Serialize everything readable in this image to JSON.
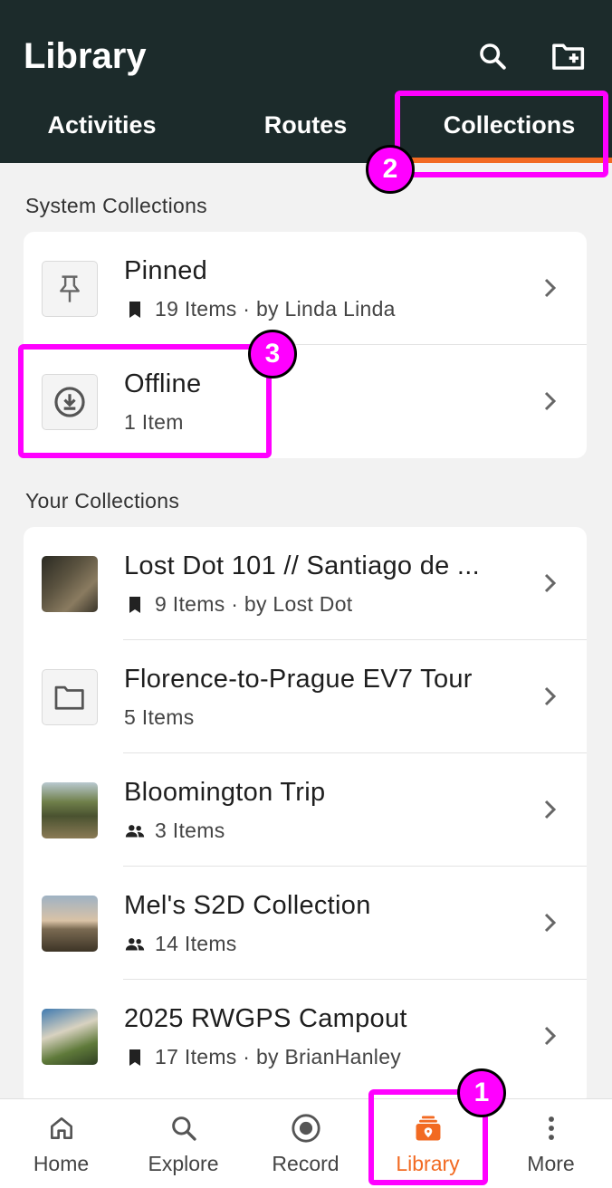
{
  "header": {
    "title": "Library",
    "search_icon": "search-icon",
    "new_folder_icon": "folder-add-icon"
  },
  "tabs": [
    {
      "label": "Activities",
      "selected": false
    },
    {
      "label": "Routes",
      "selected": false
    },
    {
      "label": "Collections",
      "selected": true
    }
  ],
  "system_collections": {
    "title": "System Collections",
    "items": [
      {
        "title": "Pinned",
        "icon": "pin-icon",
        "sub_icon": "bookmark-icon",
        "subtitle": "19 Items · by Linda Linda"
      },
      {
        "title": "Offline",
        "icon": "download-icon",
        "sub_icon": "",
        "subtitle": "1 Item"
      }
    ]
  },
  "your_collections": {
    "title": "Your Collections",
    "items": [
      {
        "title": "Lost Dot 101 // Santiago de ...",
        "icon": "photo-thumbnail",
        "sub_icon": "bookmark-icon",
        "subtitle": "9 Items · by Lost Dot"
      },
      {
        "title": "Florence-to-Prague EV7 Tour",
        "icon": "folder-icon",
        "sub_icon": "",
        "subtitle": "5 Items"
      },
      {
        "title": "Bloomington Trip",
        "icon": "photo-thumbnail",
        "sub_icon": "group-icon",
        "subtitle": "3 Items"
      },
      {
        "title": "Mel's S2D Collection",
        "icon": "photo-thumbnail",
        "sub_icon": "group-icon",
        "subtitle": "14 Items"
      },
      {
        "title": "2025 RWGPS Campout",
        "icon": "photo-thumbnail",
        "sub_icon": "bookmark-icon",
        "subtitle": "17 Items · by BrianHanley"
      }
    ]
  },
  "bottom_nav": [
    {
      "label": "Home",
      "icon": "home-icon",
      "active": false
    },
    {
      "label": "Explore",
      "icon": "search-icon",
      "active": false
    },
    {
      "label": "Record",
      "icon": "record-icon",
      "active": false
    },
    {
      "label": "Library",
      "icon": "library-icon",
      "active": true
    },
    {
      "label": "More",
      "icon": "more-vertical-icon",
      "active": false
    }
  ],
  "annotations": [
    "1",
    "2",
    "3"
  ],
  "colors": {
    "header_bg": "#1c2b2b",
    "accent": "#f26a22",
    "annotation": "#ff00ff"
  }
}
